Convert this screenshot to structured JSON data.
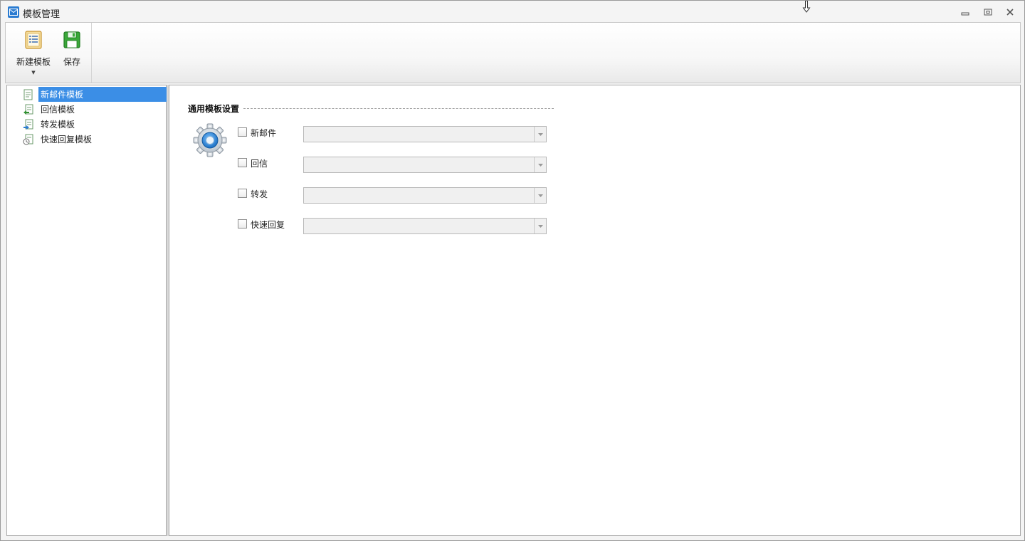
{
  "window": {
    "title": "模板管理",
    "controls": {
      "minimize": "minimize-icon",
      "restore": "restore-icon",
      "close": "close-icon"
    }
  },
  "ribbon": {
    "new_template_label": "新建模板",
    "save_label": "保存"
  },
  "tree": {
    "items": [
      {
        "label": "新邮件模板",
        "icon": "new-mail-template-icon",
        "selected": true
      },
      {
        "label": "回信模板",
        "icon": "reply-template-icon",
        "selected": false
      },
      {
        "label": "转发模板",
        "icon": "forward-template-icon",
        "selected": false
      },
      {
        "label": "快速回复模板",
        "icon": "quick-reply-template-icon",
        "selected": false
      }
    ]
  },
  "settings": {
    "group_title": "通用模板设置",
    "options": [
      {
        "label": "新邮件",
        "checked": false,
        "value": ""
      },
      {
        "label": "回信",
        "checked": false,
        "value": ""
      },
      {
        "label": "转发",
        "checked": false,
        "value": ""
      },
      {
        "label": "快速回复",
        "checked": false,
        "value": ""
      }
    ]
  },
  "colors": {
    "selection": "#3b8ee6",
    "app_icon": "#2a7bd1"
  }
}
